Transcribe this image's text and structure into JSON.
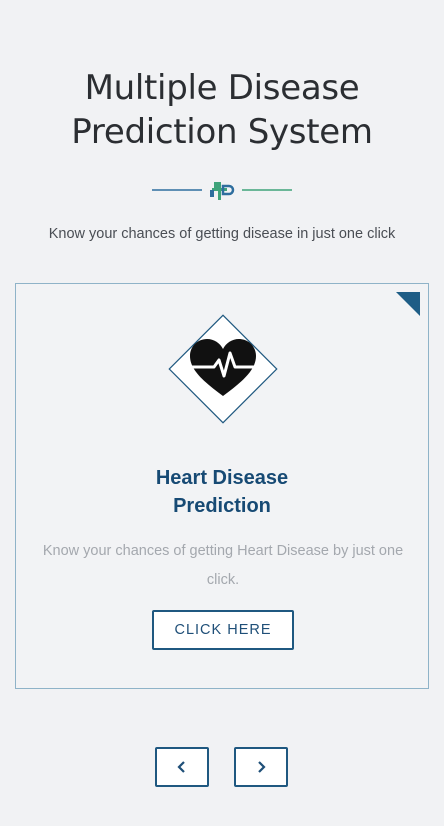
{
  "header": {
    "title_line1": "Multiple Disease",
    "title_line2": "Prediction System",
    "subtitle": "Know your chances of getting disease in just one click",
    "divider_icon": "medical-cross-icon"
  },
  "card": {
    "icon": "heart-pulse-icon",
    "title_line1": "Heart Disease",
    "title_line2": "Prediction",
    "description": "Know your chances of getting Heart Disease by just one click.",
    "button_label": "CLICK HERE"
  },
  "carousel": {
    "prev_icon": "chevron-left-icon",
    "next_icon": "chevron-right-icon"
  },
  "colors": {
    "accent": "#1f5880",
    "divider_green": "#3fa37a",
    "divider_blue": "#2e6e9e",
    "card_border": "#8fb3c8",
    "background": "#f1f2f4"
  }
}
